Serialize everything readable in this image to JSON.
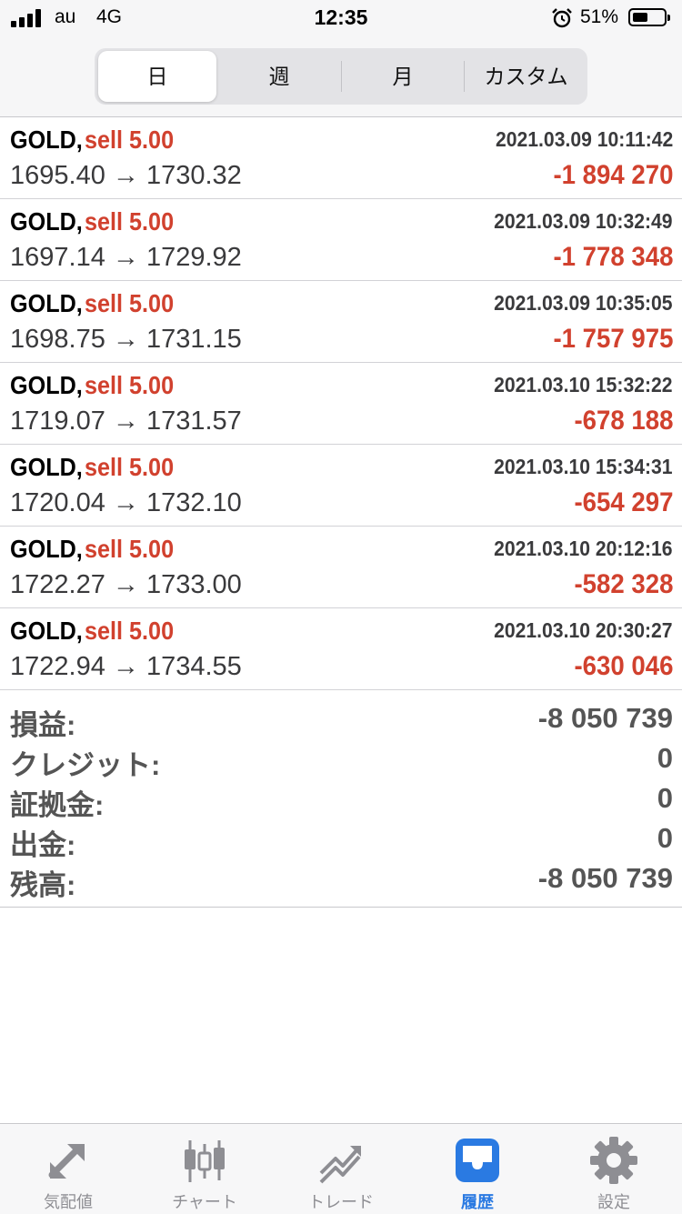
{
  "status_bar": {
    "carrier": "au",
    "network": "4G",
    "time": "12:35",
    "battery": "51%"
  },
  "segments": [
    {
      "label": "日",
      "selected": true
    },
    {
      "label": "週",
      "selected": false
    },
    {
      "label": "月",
      "selected": false
    },
    {
      "label": "カスタム",
      "selected": false
    }
  ],
  "trades": [
    {
      "symbol": "GOLD,",
      "side": "sell 5.00",
      "time": "2021.03.09 10:11:42",
      "prices": "1695.40 → 1730.32",
      "profit": "-1 894 270"
    },
    {
      "symbol": "GOLD,",
      "side": "sell 5.00",
      "time": "2021.03.09 10:32:49",
      "prices": "1697.14 → 1729.92",
      "profit": "-1 778 348"
    },
    {
      "symbol": "GOLD,",
      "side": "sell 5.00",
      "time": "2021.03.09 10:35:05",
      "prices": "1698.75 → 1731.15",
      "profit": "-1 757 975"
    },
    {
      "symbol": "GOLD,",
      "side": "sell 5.00",
      "time": "2021.03.10 15:32:22",
      "prices": "1719.07 → 1731.57",
      "profit": "-678 188"
    },
    {
      "symbol": "GOLD,",
      "side": "sell 5.00",
      "time": "2021.03.10 15:34:31",
      "prices": "1720.04 → 1732.10",
      "profit": "-654 297"
    },
    {
      "symbol": "GOLD,",
      "side": "sell 5.00",
      "time": "2021.03.10 20:12:16",
      "prices": "1722.27 → 1733.00",
      "profit": "-582 328"
    },
    {
      "symbol": "GOLD,",
      "side": "sell 5.00",
      "time": "2021.03.10 20:30:27",
      "prices": "1722.94 → 1734.55",
      "profit": "-630 046"
    }
  ],
  "summary": [
    {
      "label": "損益:",
      "value": "-8 050 739"
    },
    {
      "label": "クレジット:",
      "value": "0"
    },
    {
      "label": "証拠金:",
      "value": "0"
    },
    {
      "label": "出金:",
      "value": "0"
    },
    {
      "label": "残高:",
      "value": "-8 050 739"
    }
  ],
  "tabs": [
    {
      "label": "気配値",
      "icon": "quotes-arrows-icon",
      "active": false
    },
    {
      "label": "チャート",
      "icon": "candlestick-chart-icon",
      "active": false
    },
    {
      "label": "トレード",
      "icon": "trade-trend-icon",
      "active": false
    },
    {
      "label": "履歴",
      "icon": "history-inbox-icon",
      "active": true
    },
    {
      "label": "設定",
      "icon": "gear-icon",
      "active": false
    }
  ],
  "colors": {
    "loss_red": "#d1412e",
    "active_blue": "#2a7ae2",
    "inactive_gray": "#8e8e93"
  }
}
